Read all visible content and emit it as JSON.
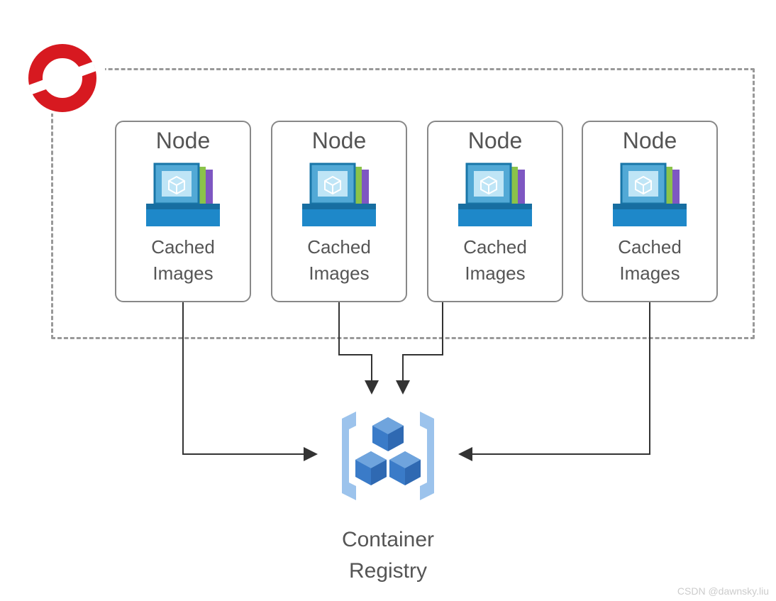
{
  "cluster": {
    "nodes": [
      {
        "title": "Node",
        "sub1": "Cached",
        "sub2": "Images"
      },
      {
        "title": "Node",
        "sub1": "Cached",
        "sub2": "Images"
      },
      {
        "title": "Node",
        "sub1": "Cached",
        "sub2": "Images"
      },
      {
        "title": "Node",
        "sub1": "Cached",
        "sub2": "Images"
      }
    ]
  },
  "registry": {
    "line1": "Container",
    "line2": "Registry"
  },
  "watermark": "CSDN @dawnsky.liu",
  "nodePositions": [
    162,
    382,
    602,
    820
  ]
}
